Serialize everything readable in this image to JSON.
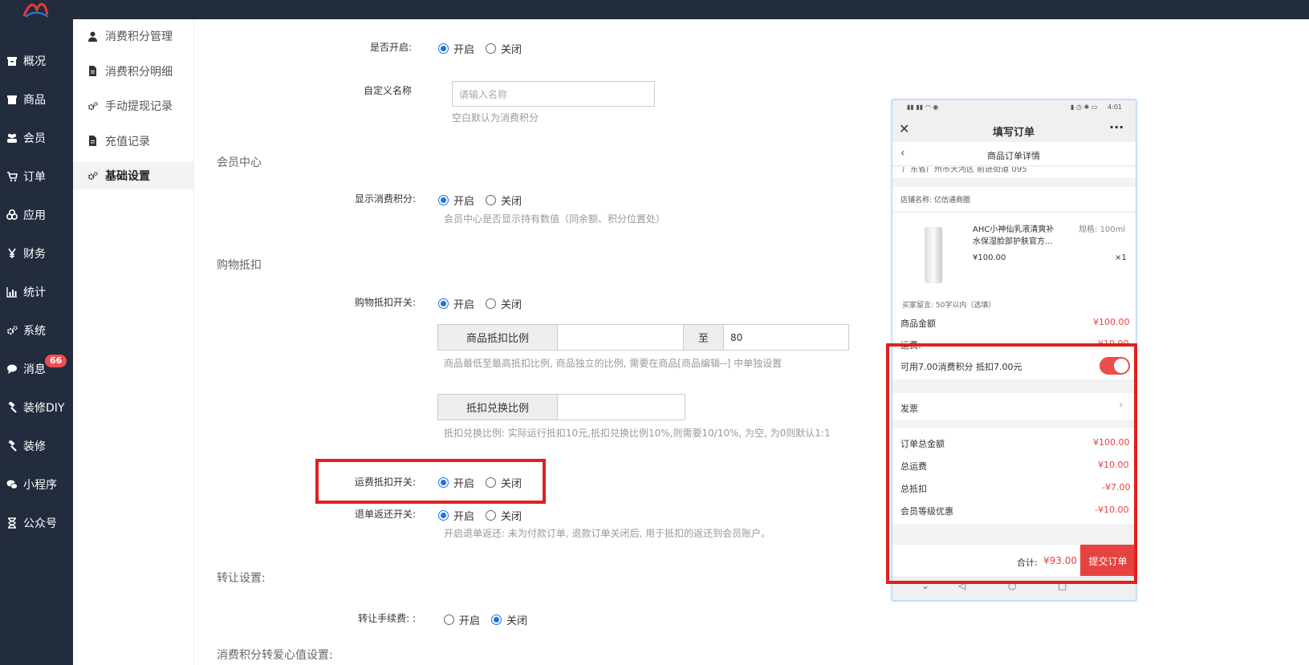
{
  "sidebar": {
    "items": [
      {
        "label": "概况",
        "icon": "archive-icon"
      },
      {
        "label": "商品",
        "icon": "box-icon"
      },
      {
        "label": "会员",
        "icon": "users-icon"
      },
      {
        "label": "订单",
        "icon": "cart-icon"
      },
      {
        "label": "应用",
        "icon": "cubes-icon"
      },
      {
        "label": "财务",
        "icon": "yen-icon"
      },
      {
        "label": "统计",
        "icon": "bar-chart-icon"
      },
      {
        "label": "系统",
        "icon": "gears-icon"
      },
      {
        "label": "消息",
        "icon": "comment-icon",
        "badge": "66"
      },
      {
        "label": "装修DIY",
        "icon": "gavel-icon"
      },
      {
        "label": "装修",
        "icon": "gavel-icon"
      },
      {
        "label": "小程序",
        "icon": "wechat-icon"
      },
      {
        "label": "公众号",
        "icon": "hourglass-icon"
      }
    ]
  },
  "subnav": {
    "items": [
      {
        "label": "消费积分管理",
        "icon": "user-icon"
      },
      {
        "label": "消费积分明细",
        "icon": "file-icon"
      },
      {
        "label": "手动提现记录",
        "icon": "gears-icon"
      },
      {
        "label": "充值记录",
        "icon": "file-icon"
      },
      {
        "label": "基础设置",
        "icon": "gears-icon",
        "active": true
      }
    ]
  },
  "form": {
    "enable_label": "是否开启:",
    "on": "开启",
    "off": "关闭",
    "custom_name_label": "自定义名称",
    "custom_name_placeholder": "请输入名称",
    "custom_name_help": "空白默认为消费积分",
    "member_center_title": "会员中心",
    "show_points_label": "显示消费积分:",
    "show_points_help": "会员中心是否显示持有数值（同余额、积分位置处）",
    "shopping_deduct_title": "购物抵扣",
    "deduct_switch_label": "购物抵扣开关:",
    "deduct_ratio_label": "商品抵扣比例",
    "to_label": "至",
    "deduct_ratio_max": "80",
    "deduct_ratio_help": "商品最低至最高抵扣比例, 商品独立的比例, 需要在商品[商品编辑--] 中单独设置",
    "exchange_ratio_label": "抵扣兑换比例",
    "exchange_ratio_help": "抵扣兑换比例: 实际运行抵扣10元,抵扣兑换比例10%,则需要10/10%, 为空, 为0则默认1:1",
    "freight_deduct_label": "运费抵扣开关:",
    "refund_return_label": "退单返还开关:",
    "refund_return_help": "开启退单返还: 未为付款订单, 退款订单关闭后, 用于抵扣的返还到会员账户。",
    "transfer_title": "转让设置:",
    "transfer_fee_label": "转让手续费: :",
    "love_value_title": "消费积分转爱心值设置:"
  },
  "phone": {
    "status_time": "4:01",
    "header_title": "填写订单",
    "close_icon": "close-icon",
    "more_icon": "more-icon",
    "sub_title": "商品订单详情",
    "address_partial": "广东省广州市天河区 前进街道 095",
    "store_name": "店铺名称: 亿信通商圈",
    "product_name_1": "AHC小神仙乳液清爽补",
    "product_name_2": "水保湿脸部护肤官方...",
    "product_spec": "规格: 100ml",
    "product_price": "¥100.00",
    "product_qty": "×1",
    "buyer_note": "买家留言:  50字以内（选填）",
    "goods_amount_label": "商品金额",
    "goods_amount": "¥100.00",
    "freight_label": "运费:",
    "freight": "¥10.00",
    "points_deduct_text": "可用7.00消费积分 抵扣7.00元",
    "invoice_label": "发票",
    "order_total_label": "订单总金额",
    "order_total": "¥100.00",
    "total_freight_label": "总运费",
    "total_freight": "¥10.00",
    "total_deduct_label": "总抵扣",
    "total_deduct": "-¥7.00",
    "member_discount_label": "会员等级优惠",
    "member_discount": "-¥10.00",
    "sum_label": "合计:",
    "sum_value": "¥93.00",
    "submit_label": "提交订单"
  },
  "colors": {
    "sidebar_bg": "#222c3c",
    "accent_blue": "#1a73e8",
    "highlight_red": "#e02020",
    "phone_red": "#e64340"
  }
}
